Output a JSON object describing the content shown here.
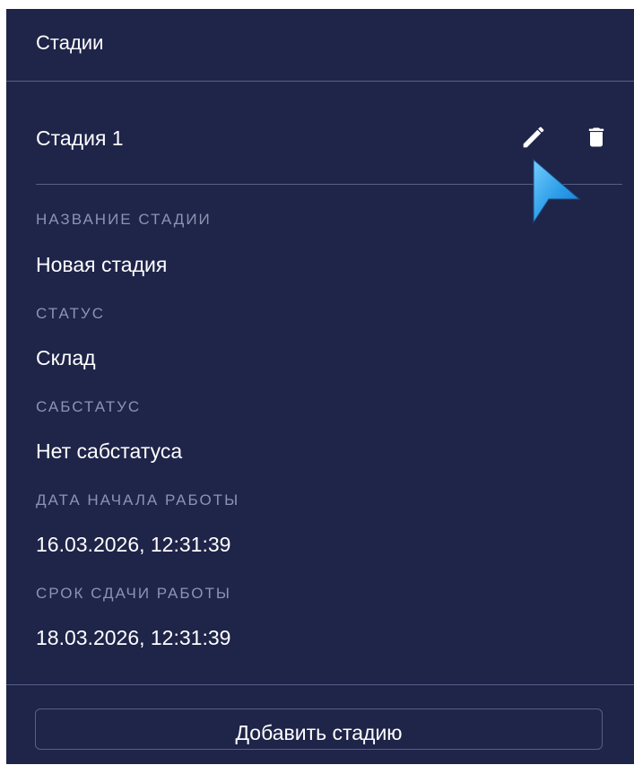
{
  "panel": {
    "title": "Стадии"
  },
  "stage": {
    "title": "Стадия 1",
    "edit_icon": "pencil-icon",
    "delete_icon": "trash-icon"
  },
  "fields": {
    "name": {
      "label": "НАЗВАНИЕ СТАДИИ",
      "value": "Новая стадия"
    },
    "status": {
      "label": "СТАТУС",
      "value": "Склад"
    },
    "substatus": {
      "label": "САБСТАТУС",
      "value": "Нет сабстатуса"
    },
    "start_date": {
      "label": "ДАТА НАЧАЛА РАБОТЫ",
      "value": "16.03.2026, 12:31:39"
    },
    "deadline": {
      "label": "СРОК СДАЧИ РАБОТЫ",
      "value": "18.03.2026, 12:31:39"
    }
  },
  "footer": {
    "add_label": "Добавить стадию"
  },
  "colors": {
    "background": "#1f2449",
    "text": "#ffffff",
    "muted": "#8d93b1",
    "divider": "#56608a",
    "cursor": "#2f9ee8"
  }
}
